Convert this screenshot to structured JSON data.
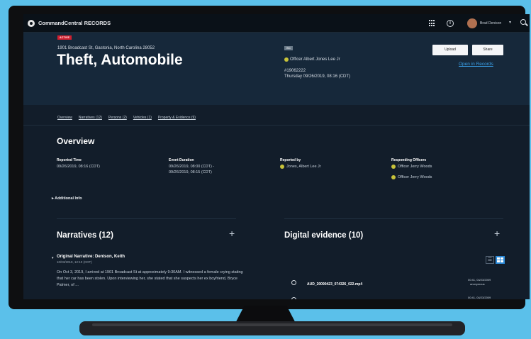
{
  "app": {
    "title": "CommandCentral RECORDS"
  },
  "topbar": {
    "user_name": "Brad Denison",
    "user_caret": "▾",
    "icons": [
      "app-grid-icon",
      "info-icon",
      "search-icon"
    ]
  },
  "incident": {
    "status_badge": "ACTIVE",
    "address": "1901 Broadcast St, Gastonia, North Carolina 28052",
    "title": "Theft, Automobile",
    "type_badge": "INC",
    "officer": "Officer Albert Jones Lee Jr",
    "case_number": "#19062222",
    "datetime": "Thursday 09/26/2019, 08:16 (CDT)",
    "upload_label": "Upload",
    "share_label": "Share",
    "open_records_label": "Open in Records"
  },
  "tabs": [
    {
      "label": "Overview"
    },
    {
      "label": "Narratives (12)"
    },
    {
      "label": "Persons (2)"
    },
    {
      "label": "Vehicles (1)"
    },
    {
      "label": "Property & Evidence (9)"
    }
  ],
  "overview": {
    "heading": "Overview",
    "reported_time_label": "Reported Time",
    "reported_time_value": "09/26/2019, 08:16 (CDT)",
    "event_duration_label": "Event Duration",
    "event_duration_line1": "09/26/2019, 08:00 (CDT) -",
    "event_duration_line2": "09/26/2019, 08:15 (CDT)",
    "reported_by_label": "Reported by",
    "reported_by_value": "Jones, Albert Lee Jr",
    "responding_label": "Responding Officers",
    "responding_officers": [
      "Officer Jerry Woods",
      "Officer Jerry Woods"
    ],
    "additional_info_label": "Additional Info"
  },
  "narratives": {
    "title": "Narratives (12)",
    "add_label": "+",
    "item_title": "Original Narrative: Denison, Keith",
    "item_date": "10/03/2019, 12:10 (CDT)",
    "item_body": "On Oct 3, 2019, I arrived at 1901 Broadcast St at approximately 9:30AM. I witnessed a female crying stating that her car has been stolen. Upon interviewing her, she stated that she suspects her ex boyfriend, Bryce Palmer, of ..."
  },
  "digital_evidence": {
    "title": "Digital evidence (10)",
    "add_label": "+",
    "list_view_label": "☰",
    "file_name": "AUD_20090423_074326_022.mp4",
    "file_meta_line1": "00:41, 04/23/2009",
    "file_meta_line2": "anonymous",
    "next_meta": "00:41, 04/23/2009"
  },
  "colors": {
    "accent": "#2b8ad8",
    "status_active": "#d22030",
    "link": "#3aa0e8",
    "background": "#121d2a"
  }
}
